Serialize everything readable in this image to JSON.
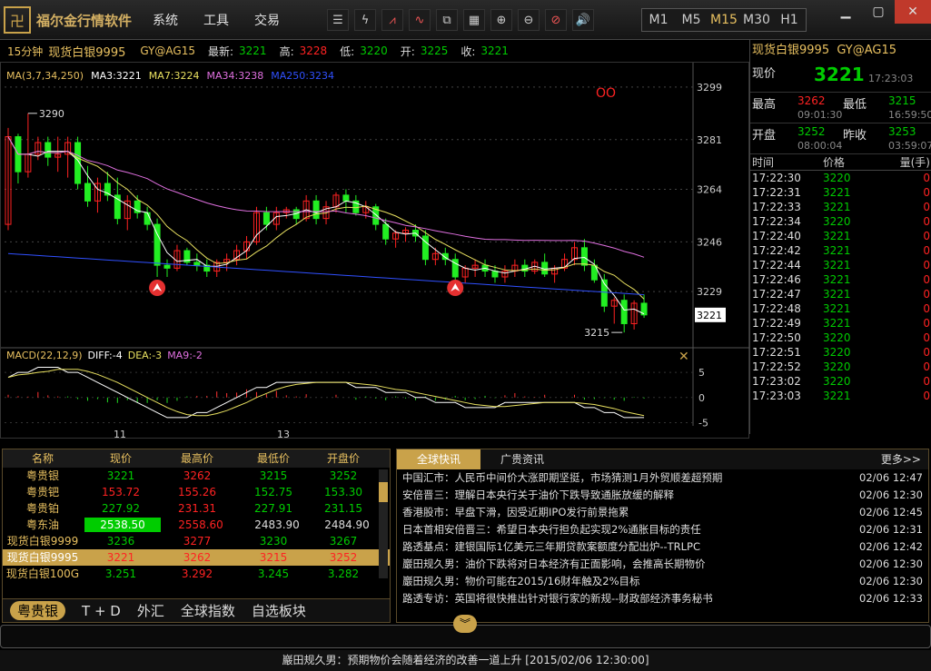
{
  "app": {
    "title": "福尔金行情软件"
  },
  "menu": [
    "系统",
    "工具",
    "交易"
  ],
  "toolbar_icons": [
    "list-icon",
    "lightning-icon",
    "chart-up-icon",
    "chart-line-icon",
    "windows-icon",
    "grid-icon",
    "zoom-in-icon",
    "zoom-out-icon",
    "clear-icon",
    "sound-icon"
  ],
  "periods": [
    "M1",
    "M5",
    "M15",
    "M30",
    "H1"
  ],
  "active_period": "M15",
  "info": {
    "period": "15分钟",
    "name": "现货白银9995",
    "code": "GY@AG15",
    "latest_label": "最新:",
    "latest": "3221",
    "high_label": "高:",
    "high": "3228",
    "low_label": "低:",
    "low": "3220",
    "open_label": "开:",
    "open": "3225",
    "close_label": "收:",
    "close": "3221"
  },
  "chart_data": {
    "type": "candlestick",
    "ma_legend": [
      "MA(3,7,34,250)",
      "MA3:3221",
      "MA7:3224",
      "MA34:3238",
      "MA250:3234"
    ],
    "y_ticks": [
      3299,
      3281,
      3264,
      3246,
      3229
    ],
    "ylim": [
      3211,
      3303
    ],
    "current_label": "3221",
    "high_annot": "3290",
    "low_annot": "3215",
    "marker_text": "OO",
    "macd_legend": [
      "MACD(22,12,9)",
      "DIFF:-4",
      "DEA:-3",
      "MA9:-2"
    ],
    "macd_ticks": [
      "5",
      "0",
      "-5"
    ],
    "x_labels": [
      "11",
      "13"
    ],
    "candles": [
      [
        3252,
        3285,
        3250,
        3282
      ],
      [
        3282,
        3283,
        3266,
        3270
      ],
      [
        3270,
        3290,
        3268,
        3276
      ],
      [
        3276,
        3282,
        3274,
        3280
      ],
      [
        3280,
        3282,
        3272,
        3275
      ],
      [
        3275,
        3282,
        3270,
        3276
      ],
      [
        3276,
        3282,
        3268,
        3280
      ],
      [
        3280,
        3282,
        3264,
        3266
      ],
      [
        3266,
        3272,
        3258,
        3260
      ],
      [
        3260,
        3268,
        3256,
        3266
      ],
      [
        3266,
        3270,
        3260,
        3262
      ],
      [
        3262,
        3268,
        3252,
        3254
      ],
      [
        3254,
        3262,
        3250,
        3260
      ],
      [
        3260,
        3262,
        3254,
        3256
      ],
      [
        3256,
        3258,
        3250,
        3252
      ],
      [
        3252,
        3254,
        3234,
        3238
      ],
      [
        3238,
        3240,
        3234,
        3237
      ],
      [
        3237,
        3245,
        3236,
        3243
      ],
      [
        3243,
        3244,
        3238,
        3239
      ],
      [
        3239,
        3242,
        3236,
        3238
      ],
      [
        3238,
        3240,
        3234,
        3236
      ],
      [
        3236,
        3240,
        3234,
        3239
      ],
      [
        3239,
        3242,
        3236,
        3240
      ],
      [
        3240,
        3245,
        3238,
        3243
      ],
      [
        3243,
        3248,
        3240,
        3246
      ],
      [
        3246,
        3258,
        3245,
        3256
      ],
      [
        3256,
        3258,
        3250,
        3252
      ],
      [
        3252,
        3258,
        3250,
        3256
      ],
      [
        3256,
        3258,
        3254,
        3257
      ],
      [
        3257,
        3258,
        3252,
        3254
      ],
      [
        3254,
        3262,
        3253,
        3260
      ],
      [
        3260,
        3262,
        3252,
        3254
      ],
      [
        3254,
        3260,
        3252,
        3258
      ],
      [
        3258,
        3263,
        3256,
        3262
      ],
      [
        3262,
        3264,
        3256,
        3260
      ],
      [
        3260,
        3262,
        3255,
        3256
      ],
      [
        3256,
        3260,
        3254,
        3258
      ],
      [
        3258,
        3259,
        3250,
        3252
      ],
      [
        3252,
        3254,
        3245,
        3247
      ],
      [
        3247,
        3250,
        3244,
        3249
      ],
      [
        3249,
        3251,
        3246,
        3250
      ],
      [
        3250,
        3252,
        3246,
        3248
      ],
      [
        3248,
        3250,
        3238,
        3240
      ],
      [
        3240,
        3244,
        3238,
        3242
      ],
      [
        3242,
        3244,
        3238,
        3240
      ],
      [
        3240,
        3242,
        3232,
        3234
      ],
      [
        3234,
        3238,
        3232,
        3237
      ],
      [
        3237,
        3240,
        3234,
        3238
      ],
      [
        3238,
        3240,
        3234,
        3236
      ],
      [
        3236,
        3238,
        3232,
        3234
      ],
      [
        3234,
        3238,
        3232,
        3236
      ],
      [
        3236,
        3240,
        3234,
        3238
      ],
      [
        3238,
        3240,
        3234,
        3236
      ],
      [
        3236,
        3240,
        3235,
        3239
      ],
      [
        3239,
        3242,
        3234,
        3235
      ],
      [
        3235,
        3238,
        3232,
        3237
      ],
      [
        3237,
        3242,
        3236,
        3240
      ],
      [
        3240,
        3246,
        3238,
        3244
      ],
      [
        3244,
        3247,
        3236,
        3238
      ],
      [
        3238,
        3240,
        3232,
        3233
      ],
      [
        3233,
        3235,
        3222,
        3224
      ],
      [
        3224,
        3227,
        3218,
        3226
      ],
      [
        3226,
        3228,
        3215,
        3218
      ],
      [
        3218,
        3226,
        3216,
        3225
      ],
      [
        3225,
        3228,
        3220,
        3221
      ]
    ],
    "macd": [
      4,
      5,
      5,
      6,
      6,
      6,
      5,
      5,
      4,
      3,
      2,
      1,
      0,
      -1,
      -2,
      -3,
      -4,
      -4,
      -4,
      -3,
      -3,
      -2,
      -1,
      0,
      1,
      2,
      2,
      3,
      3,
      3,
      3,
      3,
      3,
      3,
      3,
      2,
      2,
      2,
      1,
      1,
      1,
      0,
      0,
      -1,
      -1,
      -1,
      -2,
      -2,
      -2,
      -2,
      -1,
      -1,
      -1,
      -1,
      -1,
      -1,
      -1,
      -1,
      -2,
      -2,
      -3,
      -3,
      -4,
      -4,
      -4
    ]
  },
  "right": {
    "title_name": "现货白银9995",
    "title_code": "GY@AG15",
    "now_label": "现价",
    "now": "3221",
    "now_time": "17:23:03",
    "high_label": "最高",
    "high": "3262",
    "high_time": "09:01:30",
    "low_label": "最低",
    "low": "3215",
    "low_time": "16:59:50",
    "open_label": "开盘",
    "open": "3252",
    "open_time": "08:00:04",
    "prev_label": "昨收",
    "prev": "3253",
    "prev_time": "03:59:07",
    "tick_headers": [
      "时间",
      "价格",
      "量(手)"
    ],
    "ticks": [
      [
        "17:22:30",
        "3220",
        "0"
      ],
      [
        "17:22:31",
        "3221",
        "0"
      ],
      [
        "17:22:33",
        "3221",
        "0"
      ],
      [
        "17:22:34",
        "3220",
        "0"
      ],
      [
        "17:22:40",
        "3221",
        "0"
      ],
      [
        "17:22:42",
        "3221",
        "0"
      ],
      [
        "17:22:44",
        "3221",
        "0"
      ],
      [
        "17:22:46",
        "3221",
        "0"
      ],
      [
        "17:22:47",
        "3221",
        "0"
      ],
      [
        "17:22:48",
        "3221",
        "0"
      ],
      [
        "17:22:49",
        "3221",
        "0"
      ],
      [
        "17:22:50",
        "3220",
        "0"
      ],
      [
        "17:22:51",
        "3220",
        "0"
      ],
      [
        "17:22:52",
        "3220",
        "0"
      ],
      [
        "17:23:02",
        "3220",
        "0"
      ],
      [
        "17:23:03",
        "3221",
        "0"
      ]
    ]
  },
  "quotes": {
    "headers": [
      "名称",
      "现价",
      "最高价",
      "最低价",
      "开盘价"
    ],
    "rows": [
      {
        "name": "粤贵银",
        "price": "3221",
        "high": "3262",
        "low": "3215",
        "open": "3252",
        "pc": "g",
        "hc": "r",
        "lc": "g",
        "oc": "g"
      },
      {
        "name": "粤贵钯",
        "price": "153.72",
        "high": "155.26",
        "low": "152.75",
        "open": "153.30",
        "pc": "r",
        "hc": "r",
        "lc": "g",
        "oc": "g"
      },
      {
        "name": "粤贵铂",
        "price": "227.92",
        "high": "231.31",
        "low": "227.91",
        "open": "231.15",
        "pc": "g",
        "hc": "r",
        "lc": "g",
        "oc": "g"
      },
      {
        "name": "粤东油",
        "price": "2538.50",
        "high": "2558.60",
        "low": "2483.90",
        "open": "2484.90",
        "pc": "box",
        "hc": "r",
        "lc": "w",
        "oc": "w"
      },
      {
        "name": "现货白银9999",
        "price": "3236",
        "high": "3277",
        "low": "3230",
        "open": "3267",
        "pc": "g",
        "hc": "r",
        "lc": "g",
        "oc": "g"
      },
      {
        "name": "现货白银9995",
        "price": "3221",
        "high": "3262",
        "low": "3215",
        "open": "3252",
        "pc": "g",
        "hc": "r",
        "lc": "g",
        "oc": "g",
        "sel": true
      },
      {
        "name": "现货白银100G",
        "price": "3.251",
        "high": "3.292",
        "low": "3.245",
        "open": "3.282",
        "pc": "g",
        "hc": "r",
        "lc": "g",
        "oc": "g"
      }
    ],
    "tabs": [
      "粤贵银",
      "T + D",
      "外汇",
      "全球指数",
      "自选板块"
    ]
  },
  "news": {
    "tabs": [
      "全球快讯",
      "广贵资讯"
    ],
    "more": "更多>>",
    "items": [
      [
        "中国汇市：人民币中间价大涨即期坚挺，市场猜测1月外贸顺差超预期",
        "02/06 12:47"
      ],
      [
        "安倍晋三：理解日本央行关于油价下跌导致通胀放缓的解释",
        "02/06 12:30"
      ],
      [
        "香港股市：早盘下滑，因受近期IPO发行前景拖累",
        "02/06 12:45"
      ],
      [
        "日本首相安倍晋三：希望日本央行担负起实现2%通胀目标的责任",
        "02/06 12:31"
      ],
      [
        "路透基点：建银国际1亿美元三年期贷款案额度分配出炉--TRLPC",
        "02/06 12:42"
      ],
      [
        "巖田规久男：油价下跌将对日本经济有正面影响，会推高长期物价",
        "02/06 12:30"
      ],
      [
        "巖田规久男：物价可能在2015/16财年触及2%目标",
        "02/06 12:30"
      ],
      [
        "路透专访：英国将很快推出针对银行家的新规--财政部经济事务秘书",
        "02/06 12:33"
      ]
    ]
  },
  "bottom": {
    "ticker": "巖田规久男：预期物价会随着经济的改善一道上升 [2015/02/06 12:30:00]"
  }
}
